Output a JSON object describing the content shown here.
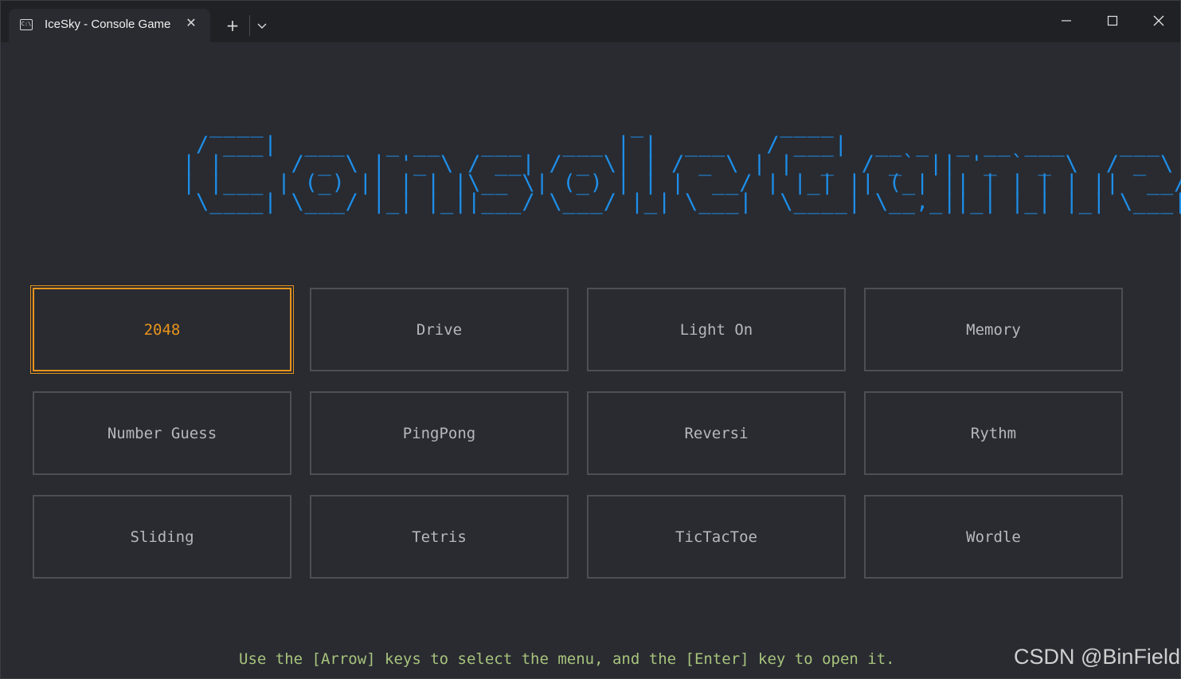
{
  "window": {
    "tab_title": "IceSky - Console Game",
    "tab_icon": "terminal-icon",
    "tab_icon_glyph": "C:\\",
    "close_tab_glyph": "✕",
    "new_tab_glyph": "+"
  },
  "banner": {
    "ascii_art": "  ____                           _          ____                           \n / ___|  ___   _ __   ___   ___ | |  ___   / ___|  __ _  _ __ ___    ___ \n| |     / _ \\ | '_ \\ / __| / _ \\| | / _ \\ | |  _  / _` || '_ ` _ \\  / _ \\\n| |___ | (_) || | | |\\__ \\| (_) | | |  __/ | |_| || (_| || | | | | ||  __/\n \\____| \\___/ |_| |_||___/ \\___/ |_| \\___|  \\____| \\__,_||_| |_| |_| \\___|"
  },
  "menu": {
    "selected": "2048",
    "items": [
      {
        "label": "2048"
      },
      {
        "label": "Drive"
      },
      {
        "label": "Light On"
      },
      {
        "label": "Memory"
      },
      {
        "label": "Number Guess"
      },
      {
        "label": "PingPong"
      },
      {
        "label": "Reversi"
      },
      {
        "label": "Rythm"
      },
      {
        "label": "Sliding"
      },
      {
        "label": "Tetris"
      },
      {
        "label": "TicTacToe"
      },
      {
        "label": "Wordle"
      }
    ]
  },
  "hint": "Use the [Arrow] keys to select the menu, and the [Enter] key to open it.",
  "watermark": "CSDN @BinField",
  "colors": {
    "background": "#292b31",
    "ascii": "#1e8ee8",
    "selected": "#e8941c",
    "item_text": "#b6b8bd",
    "hint": "#a8c37c"
  }
}
